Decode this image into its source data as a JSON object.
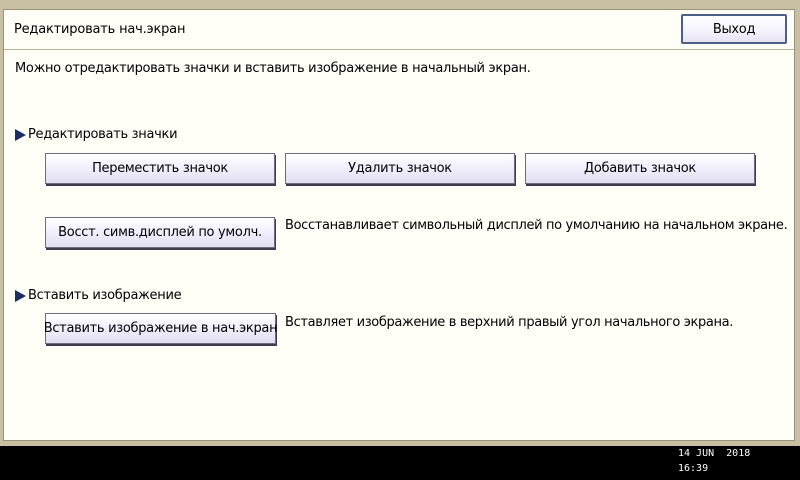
{
  "header": {
    "title": "Редактировать нач.экран",
    "exit_label": "Выход"
  },
  "intro": "Можно отредактировать значки и вставить изображение в начальный экран.",
  "edit_icons": {
    "title": "Редактировать значки",
    "move_label": "Переместить значок",
    "delete_label": "Удалить значок",
    "add_label": "Добавить значок",
    "restore_label": "Восст. симв.дисплей по умолч.",
    "restore_desc": "Восстанавливает символьный дисплей по умолчанию на начальном экране."
  },
  "insert_image": {
    "title": "Вставить изображение",
    "insert_label": "Вставить изображение в нач.экран",
    "insert_desc": "Вставляет изображение в верхний правый угол начального экрана."
  },
  "status": {
    "date": "14 JUN  2018",
    "time": "16:39"
  },
  "colors": {
    "background": "#c9c0a4",
    "panel": "#fffff8",
    "accent_triangle": "#1c2d63",
    "exit_border": "#4d5f86"
  },
  "icons": {
    "section_marker": "triangle-right-icon"
  }
}
